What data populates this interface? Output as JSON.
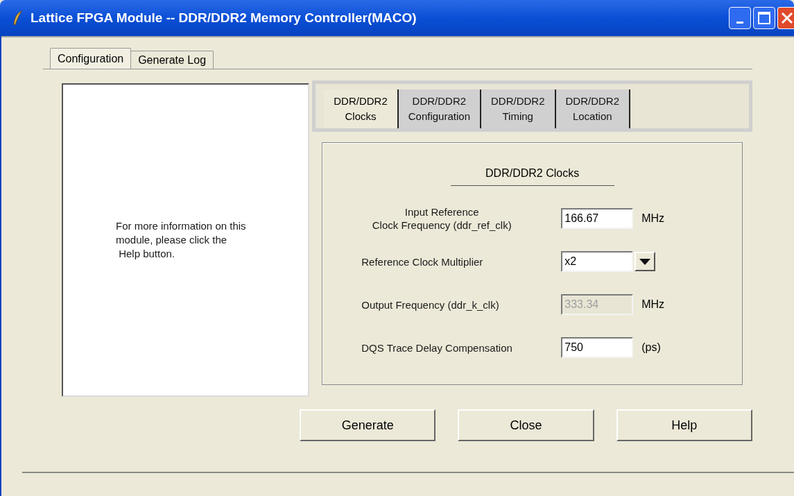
{
  "window": {
    "title": "Lattice FPGA Module -- DDR/DDR2 Memory Controller(MACO)"
  },
  "tabs": [
    {
      "label": "Configuration",
      "selected": true
    },
    {
      "label": "Generate Log",
      "selected": false
    }
  ],
  "info_text": [
    "For more information on this",
    "module, please click the",
    " Help button."
  ],
  "subtabs": [
    {
      "lines": [
        "DDR/DDR2",
        "Clocks"
      ],
      "selected": true
    },
    {
      "lines": [
        "DDR/DDR2",
        "Configuration"
      ],
      "selected": false
    },
    {
      "lines": [
        "DDR/DDR2",
        "Timing"
      ],
      "selected": false
    },
    {
      "lines": [
        "DDR/DDR2",
        "Location"
      ],
      "selected": false
    }
  ],
  "section_title": "DDR/DDR2 Clocks",
  "fields": [
    {
      "kind": "text",
      "label": [
        "Input Reference",
        "Clock Frequency (ddr_ref_clk)"
      ],
      "value": "166.67",
      "unit": "MHz",
      "disabled": false
    },
    {
      "kind": "dropdown",
      "label": [
        "Reference Clock Multiplier"
      ],
      "value": "x2",
      "disabled": false
    },
    {
      "kind": "text",
      "label": [
        "Output Frequency (ddr_k_clk)"
      ],
      "value": "333.34",
      "unit": "MHz",
      "disabled": true
    },
    {
      "kind": "text",
      "label": [
        "DQS Trace Delay Compensation"
      ],
      "value": "750",
      "unit": "(ps)",
      "disabled": false
    }
  ],
  "buttons": [
    "Generate",
    "Close",
    "Help"
  ]
}
